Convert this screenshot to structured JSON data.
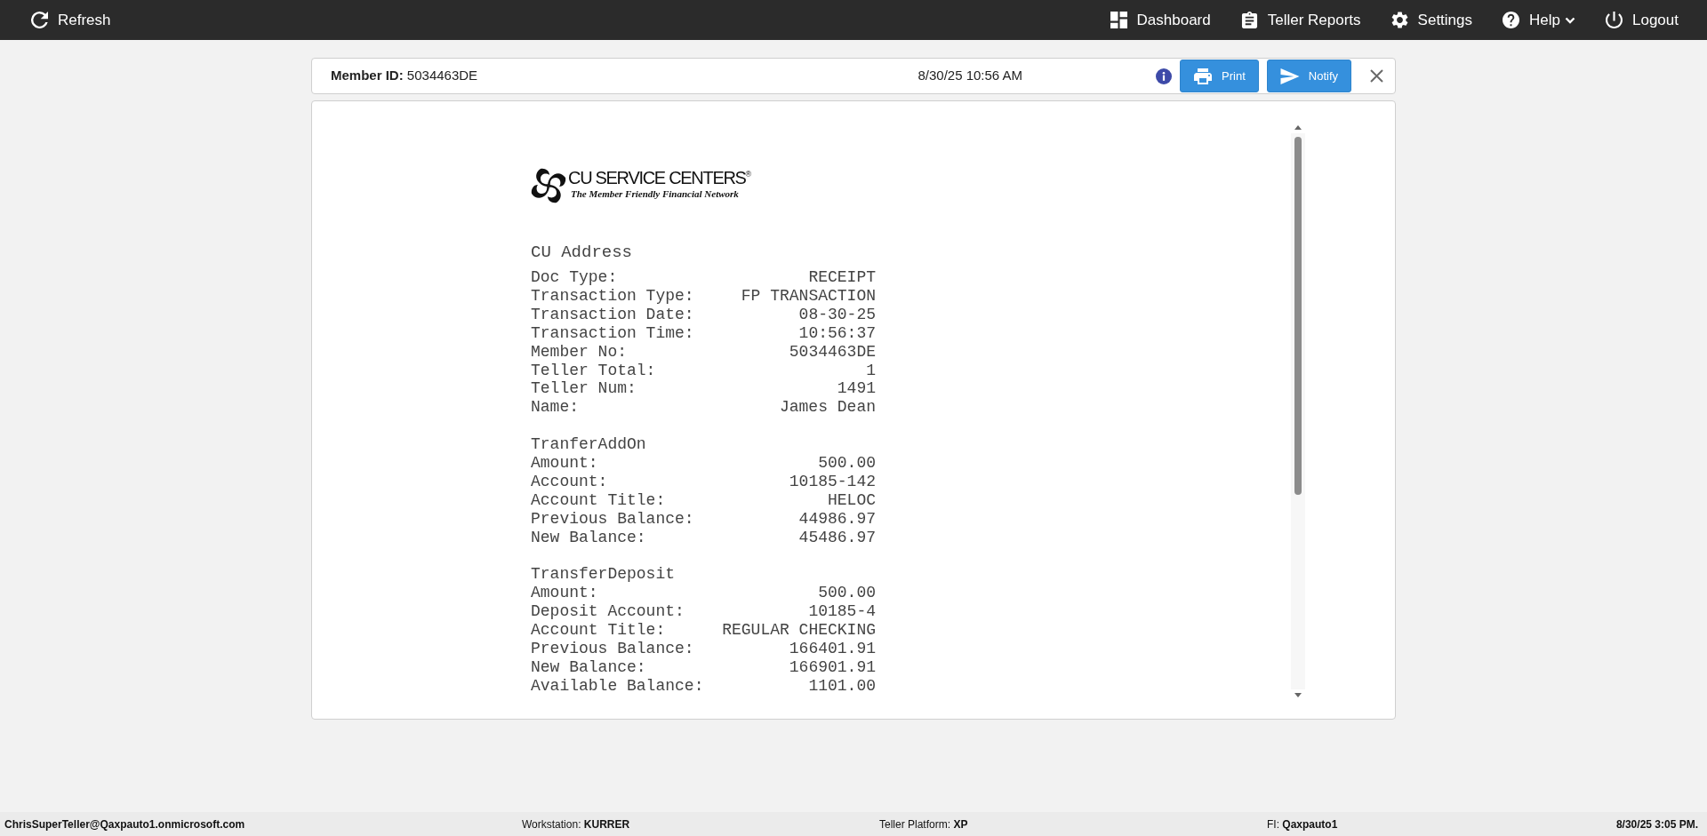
{
  "navbar": {
    "left": [
      {
        "label": "Refresh"
      }
    ],
    "right": [
      {
        "label": "Dashboard",
        "has_menu": false
      },
      {
        "label": "Teller Reports",
        "has_menu": false
      },
      {
        "label": "Settings",
        "has_menu": false
      },
      {
        "label": "Help",
        "has_menu": true
      },
      {
        "label": "Logout",
        "has_menu": false
      }
    ]
  },
  "member_bar": {
    "label": "Member ID:",
    "member_id": "5034463DE",
    "datetime": "8/30/25 10:56 AM",
    "buttons": [
      {
        "label": "Print"
      },
      {
        "label": "Notify"
      }
    ]
  },
  "receipt": {
    "logo": {
      "name": "CU SERVICE CENTERS$^{®}$",
      "tagline": "The Member Friendly Financial Network"
    },
    "heading": "CU Address",
    "sections": [
      {
        "rows": [
          {
            "label": "Doc Type:",
            "value": "RECEIPT"
          },
          {
            "label": "Transaction Type:",
            "value": "FP TRANSACTION"
          },
          {
            "label": "Transaction Date:",
            "value": "08-30-25"
          },
          {
            "label": "Transaction Time:",
            "value": "10:56:37"
          },
          {
            "label": "Member No:",
            "value": "5034463DE"
          },
          {
            "label": "Teller Total:",
            "value": "1"
          },
          {
            "label": "Teller Num:",
            "value": "1491"
          },
          {
            "label": "Name:",
            "value": "James Dean"
          }
        ]
      },
      {
        "title": "TranferAddOn",
        "rows": [
          {
            "label": "Amount:",
            "value": "500.00"
          },
          {
            "label": "Account:",
            "value": "10185-142"
          },
          {
            "label": "Account Title:",
            "value": "HELOC"
          },
          {
            "label": "Previous Balance:",
            "value": "44986.97"
          },
          {
            "label": "New Balance:",
            "value": "45486.97"
          }
        ]
      },
      {
        "title": "TransferDeposit",
        "rows": [
          {
            "label": "Amount:",
            "value": "500.00"
          },
          {
            "label": "Deposit Account:",
            "value": "10185-4"
          },
          {
            "label": "Account Title:",
            "value": "REGULAR CHECKING"
          },
          {
            "label": "Previous Balance:",
            "value": "166401.91"
          },
          {
            "label": "New Balance:",
            "value": "166901.91"
          },
          {
            "label": "Available Balance:",
            "value": "1101.00"
          }
        ]
      }
    ]
  },
  "status_bar": {
    "items": [
      {
        "value": "ChrisSuperTeller@Qaxpauto1.onmicrosoft.com"
      },
      {
        "label": "Workstation:",
        "value": "KURRER"
      },
      {
        "label": "Teller Platform:",
        "value": "XP"
      },
      {
        "label": "FI:",
        "value": "Qaxpauto1"
      },
      {
        "value": "8/30/25 3:05 PM."
      }
    ]
  }
}
